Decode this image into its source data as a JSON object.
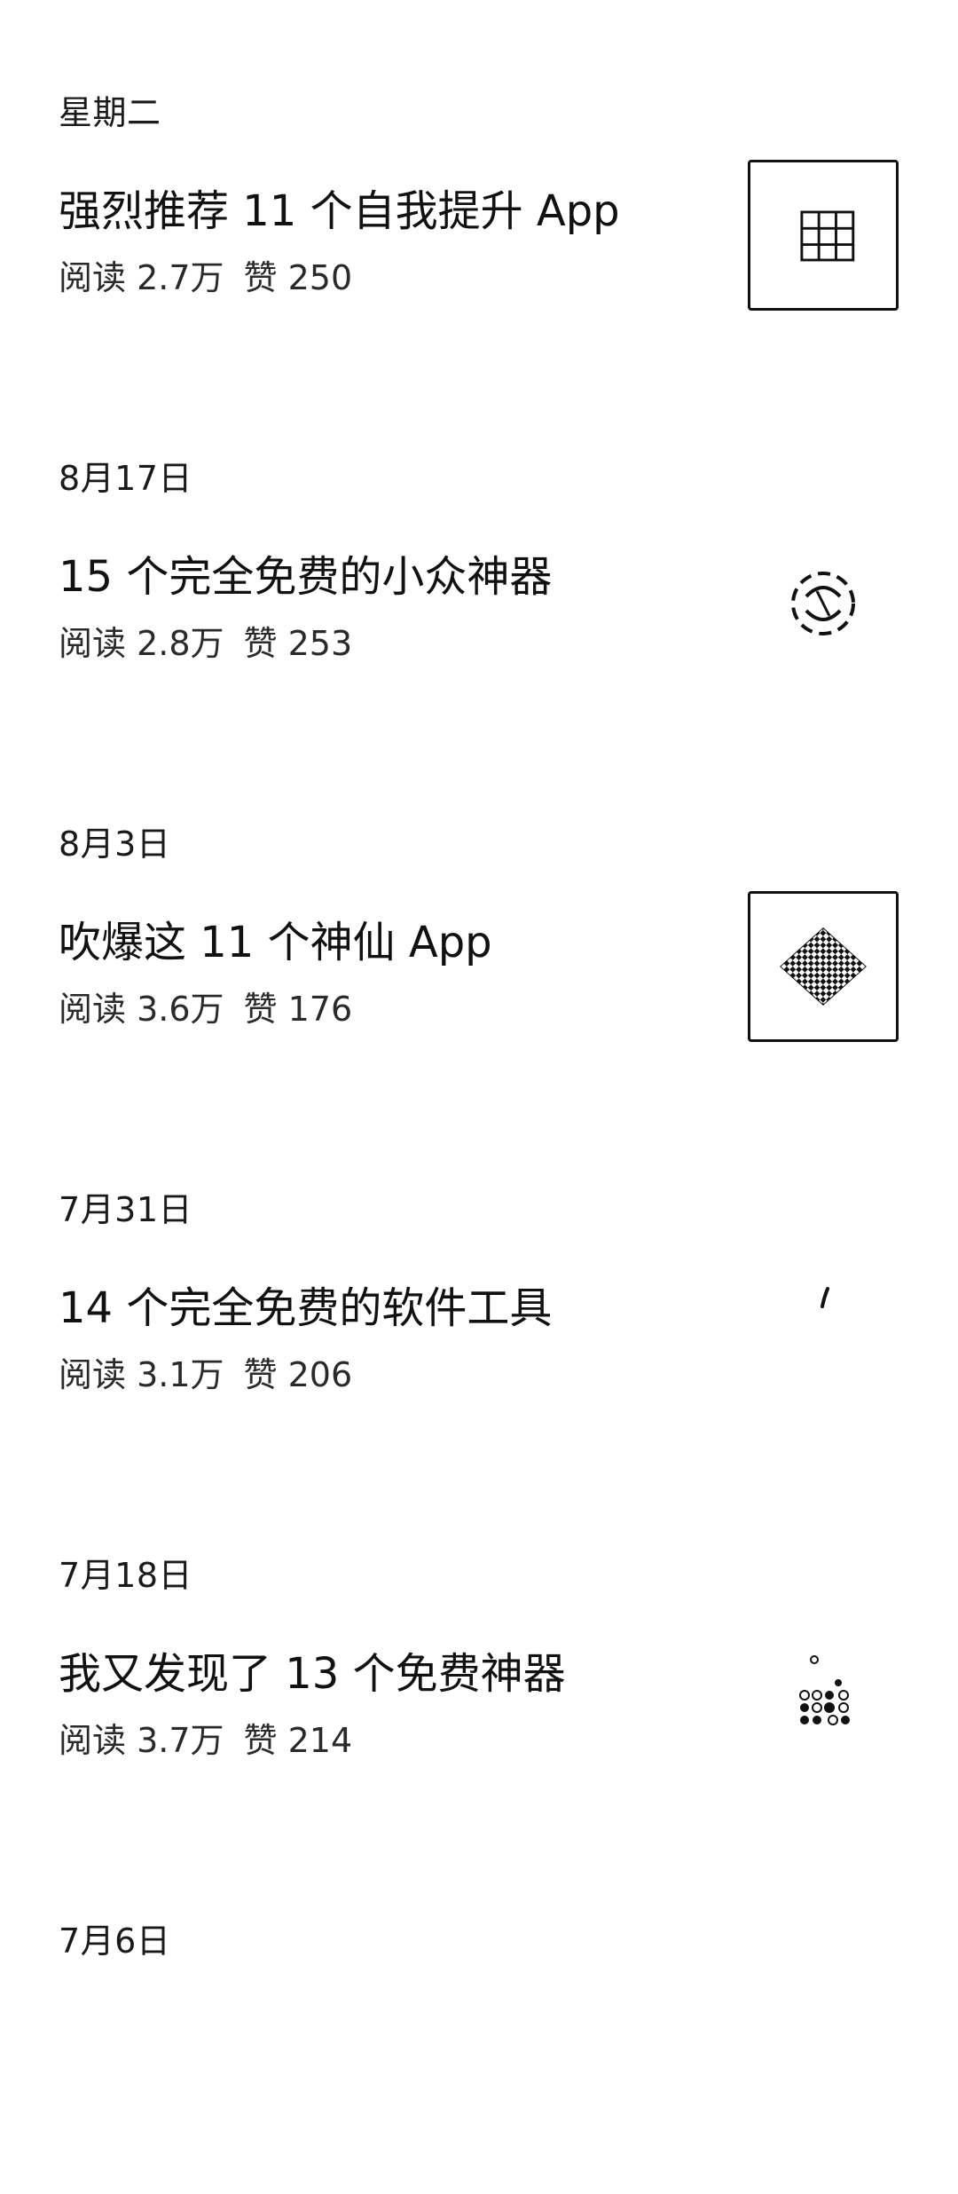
{
  "articles": [
    {
      "date": "星期二",
      "title": "强烈推荐 11 个自我提升 App",
      "reads": "阅读 2.7万",
      "likes": "赞 250",
      "thumb_icon": "grid-icon"
    },
    {
      "date": "8月17日",
      "title": "15 个完全免费的小众神器",
      "reads": "阅读 2.8万",
      "likes": "赞 253",
      "thumb_icon": "swirl-logo-icon"
    },
    {
      "date": "8月3日",
      "title": "吹爆这 11 个神仙 App",
      "reads": "阅读 3.6万",
      "likes": "赞 176",
      "thumb_icon": "checkered-diamond-icon"
    },
    {
      "date": "7月31日",
      "title": "14 个完全免费的软件工具",
      "reads": "阅读 3.1万",
      "likes": "赞 206",
      "thumb_icon": "leaf-mark-icon"
    },
    {
      "date": "7月18日",
      "title": "我又发现了 13 个免费神器",
      "reads": "阅读 3.7万",
      "likes": "赞 214",
      "thumb_icon": "dots-pattern-icon"
    },
    {
      "date": "7月6日",
      "title": "",
      "reads": "",
      "likes": "",
      "thumb_icon": ""
    }
  ]
}
